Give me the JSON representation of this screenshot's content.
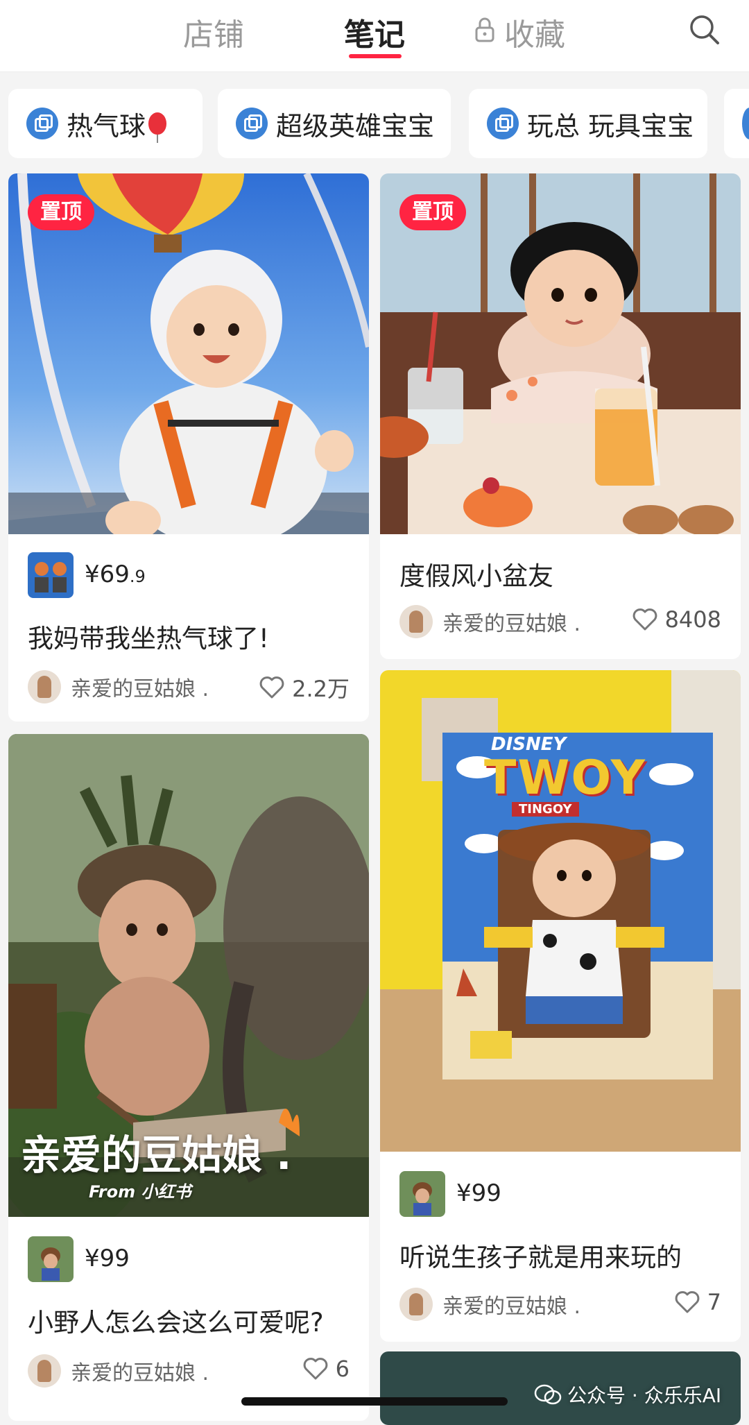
{
  "tabs": [
    {
      "label": "店铺",
      "active": false
    },
    {
      "label": "笔记",
      "active": true
    },
    {
      "label": "收藏",
      "active": false
    }
  ],
  "chips": [
    {
      "label": "热气球",
      "icon": "collection-icon",
      "emoji": "balloon-icon"
    },
    {
      "label": "超级英雄宝宝",
      "icon": "collection-icon"
    },
    {
      "label": "玩总 玩具宝宝",
      "icon": "collection-icon"
    }
  ],
  "cards": [
    {
      "badge": "置顶",
      "price_main": "¥69",
      "price_cents": ".9",
      "title": "我妈带我坐热气球了!",
      "author": "亲爱的豆姑娘 .",
      "likes": "2.2万"
    },
    {
      "badge": "置顶",
      "title": "度假风小盆友",
      "author": "亲爱的豆姑娘 .",
      "likes": "8408"
    },
    {
      "overlay_name": "亲爱的豆姑娘 .",
      "overlay_from": "From 小红书",
      "price_main": "¥99",
      "title": "小野人怎么会这么可爱呢?",
      "author": "亲爱的豆姑娘 .",
      "likes": "6"
    },
    {
      "poster_top": "DISNEY",
      "poster_title": "TWOY",
      "poster_sub": "TINGOY",
      "price_main": "¥99",
      "title": "听说生孩子就是用来玩的",
      "author": "亲爱的豆姑娘 .",
      "likes": "7"
    }
  ],
  "watermark": "公众号 · 众乐乐AI",
  "colors": {
    "accent": "#ff2442",
    "chip_icon": "#3b82d6"
  }
}
